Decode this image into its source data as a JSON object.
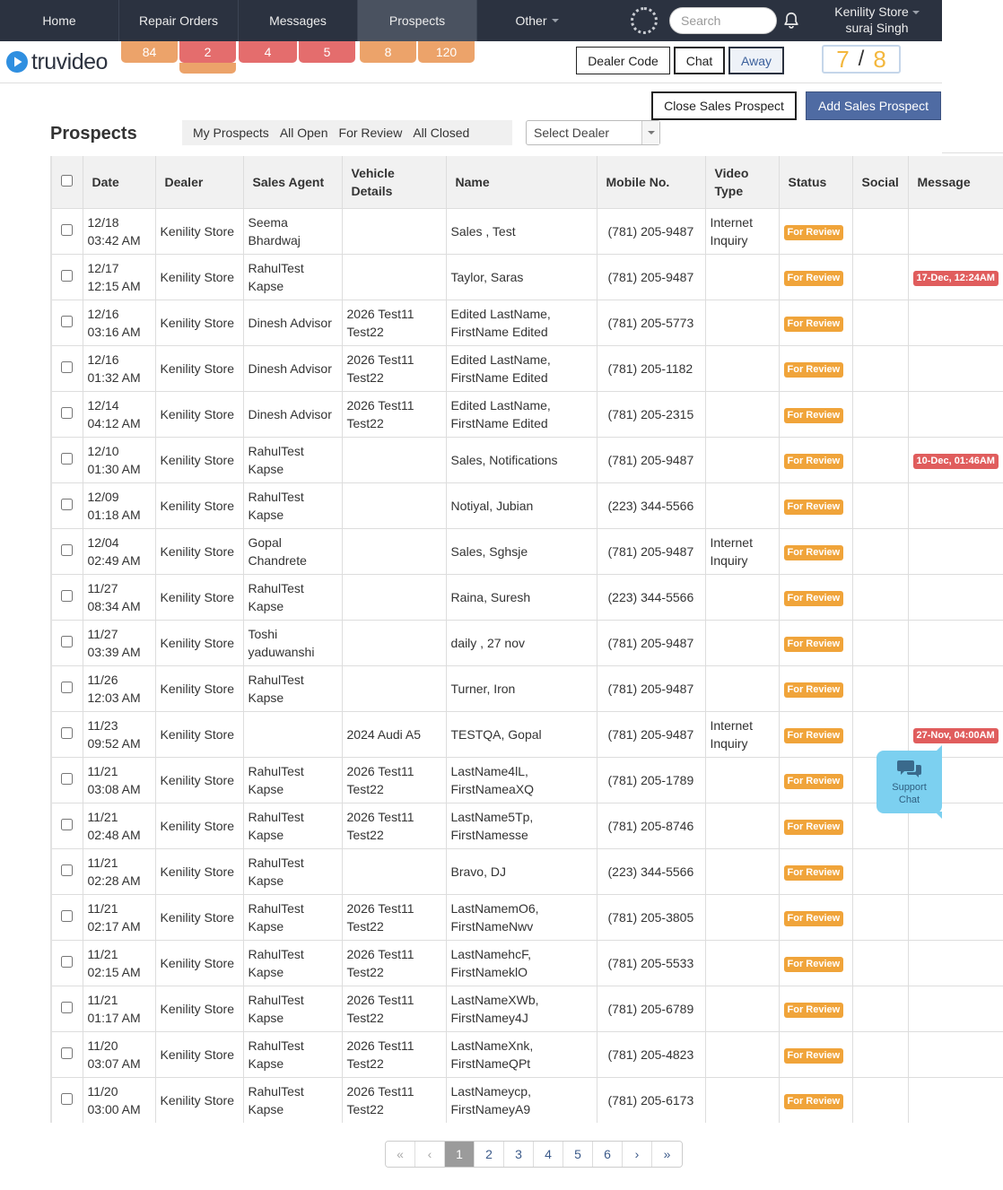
{
  "nav": {
    "items": [
      {
        "label": "Home",
        "active": false
      },
      {
        "label": "Repair Orders",
        "active": false
      },
      {
        "label": "Messages",
        "active": false
      },
      {
        "label": "Prospects",
        "active": true
      },
      {
        "label": "Other",
        "active": false
      }
    ],
    "search_placeholder": "Search",
    "store_name": "Kenility Store",
    "user_name": "suraj Singh"
  },
  "logo_text": "truvideo",
  "badges": [
    {
      "value": "84",
      "color": "orange"
    },
    {
      "value": "2",
      "color": "red"
    },
    {
      "value": "4",
      "color": "red"
    },
    {
      "value": "5",
      "color": "red"
    },
    {
      "value": "8",
      "color": "orange"
    },
    {
      "value": "120",
      "color": "orange"
    }
  ],
  "header_buttons": {
    "dealer_code": "Dealer Code",
    "chat": "Chat",
    "away": "Away"
  },
  "counter": {
    "left": "7",
    "sep": "/",
    "right": "8"
  },
  "toolbar": {
    "close_label": "Close Sales Prospect",
    "add_label": "Add Sales Prospect"
  },
  "page_title": "Prospects",
  "filter_tabs": [
    "My Prospects",
    "All Open",
    "For Review",
    "All Closed"
  ],
  "dealer_select_value": "Select Dealer",
  "table": {
    "columns": [
      "Date",
      "Dealer",
      "Sales Agent",
      "Vehicle Details",
      "Name",
      "Mobile No.",
      "Video Type",
      "Status",
      "Social",
      "Message"
    ],
    "rows": [
      {
        "date": "12/18\n03:42 AM",
        "dealer": "Kenility Store",
        "agent": "Seema Bhardwaj",
        "vehicle": "",
        "name": "Sales , Test",
        "mobile": "(781) 205-9487",
        "video_type": "Internet Inquiry",
        "status": "For Review",
        "social": "",
        "message": ""
      },
      {
        "date": "12/17\n12:15 AM",
        "dealer": "Kenility Store",
        "agent": "RahulTest Kapse",
        "vehicle": "",
        "name": "Taylor, Saras",
        "mobile": "(781) 205-9487",
        "video_type": "",
        "status": "For Review",
        "social": "",
        "message": "17-Dec, 12:24AM"
      },
      {
        "date": "12/16\n03:16 AM",
        "dealer": "Kenility Store",
        "agent": "Dinesh Advisor",
        "vehicle": "2026 Test11 Test22",
        "name": "Edited LastName, FirstName Edited",
        "mobile": "(781) 205-5773",
        "video_type": "",
        "status": "For Review",
        "social": "",
        "message": ""
      },
      {
        "date": "12/16\n01:32 AM",
        "dealer": "Kenility Store",
        "agent": "Dinesh Advisor",
        "vehicle": "2026 Test11 Test22",
        "name": "Edited LastName, FirstName Edited",
        "mobile": "(781) 205-1182",
        "video_type": "",
        "status": "For Review",
        "social": "",
        "message": ""
      },
      {
        "date": "12/14\n04:12 AM",
        "dealer": "Kenility Store",
        "agent": "Dinesh Advisor",
        "vehicle": "2026 Test11 Test22",
        "name": "Edited LastName, FirstName Edited",
        "mobile": "(781) 205-2315",
        "video_type": "",
        "status": "For Review",
        "social": "",
        "message": ""
      },
      {
        "date": "12/10\n01:30 AM",
        "dealer": "Kenility Store",
        "agent": "RahulTest Kapse",
        "vehicle": "",
        "name": "Sales, Notifications",
        "mobile": "(781) 205-9487",
        "video_type": "",
        "status": "For Review",
        "social": "",
        "message": "10-Dec, 01:46AM"
      },
      {
        "date": "12/09\n01:18 AM",
        "dealer": "Kenility Store",
        "agent": "RahulTest Kapse",
        "vehicle": "",
        "name": "Notiyal, Jubian",
        "mobile": "(223) 344-5566",
        "video_type": "",
        "status": "For Review",
        "social": "",
        "message": ""
      },
      {
        "date": "12/04\n02:49 AM",
        "dealer": "Kenility Store",
        "agent": "Gopal Chandrete",
        "vehicle": "",
        "name": "Sales, Sghsje",
        "mobile": "(781) 205-9487",
        "video_type": "Internet Inquiry",
        "status": "For Review",
        "social": "",
        "message": ""
      },
      {
        "date": "11/27\n08:34 AM",
        "dealer": "Kenility Store",
        "agent": "RahulTest Kapse",
        "vehicle": "",
        "name": "Raina, Suresh",
        "mobile": "(223) 344-5566",
        "video_type": "",
        "status": "For Review",
        "social": "",
        "message": ""
      },
      {
        "date": "11/27\n03:39 AM",
        "dealer": "Kenility Store",
        "agent": "Toshi yaduwanshi",
        "vehicle": "",
        "name": "daily , 27 nov",
        "mobile": "(781) 205-9487",
        "video_type": "",
        "status": "For Review",
        "social": "",
        "message": ""
      },
      {
        "date": "11/26\n12:03 AM",
        "dealer": "Kenility Store",
        "agent": "RahulTest Kapse",
        "vehicle": "",
        "name": "Turner, Iron",
        "mobile": "(781) 205-9487",
        "video_type": "",
        "status": "For Review",
        "social": "",
        "message": ""
      },
      {
        "date": "11/23\n09:52 AM",
        "dealer": "Kenility Store",
        "agent": "",
        "vehicle": "2024 Audi A5",
        "name": "TESTQA, Gopal",
        "mobile": "(781) 205-9487",
        "video_type": "Internet Inquiry",
        "status": "For Review",
        "social": "",
        "message": "27-Nov, 04:00AM"
      },
      {
        "date": "11/21\n03:08 AM",
        "dealer": "Kenility Store",
        "agent": "RahulTest Kapse",
        "vehicle": "2026 Test11 Test22",
        "name": "LastName4lL, FirstNameaXQ",
        "mobile": "(781) 205-1789",
        "video_type": "",
        "status": "For Review",
        "social": "",
        "message": ""
      },
      {
        "date": "11/21\n02:48 AM",
        "dealer": "Kenility Store",
        "agent": "RahulTest Kapse",
        "vehicle": "2026 Test11 Test22",
        "name": "LastName5Tp, FirstNamesse",
        "mobile": "(781) 205-8746",
        "video_type": "",
        "status": "For Review",
        "social": "",
        "message": ""
      },
      {
        "date": "11/21\n02:28 AM",
        "dealer": "Kenility Store",
        "agent": "RahulTest Kapse",
        "vehicle": "",
        "name": "Bravo, DJ",
        "mobile": "(223) 344-5566",
        "video_type": "",
        "status": "For Review",
        "social": "",
        "message": ""
      },
      {
        "date": "11/21\n02:17 AM",
        "dealer": "Kenility Store",
        "agent": "RahulTest Kapse",
        "vehicle": "2026 Test11 Test22",
        "name": "LastNamemO6, FirstNameNwv",
        "mobile": "(781) 205-3805",
        "video_type": "",
        "status": "For Review",
        "social": "",
        "message": ""
      },
      {
        "date": "11/21\n02:15 AM",
        "dealer": "Kenility Store",
        "agent": "RahulTest Kapse",
        "vehicle": "2026 Test11 Test22",
        "name": "LastNamehcF, FirstNameklO",
        "mobile": "(781) 205-5533",
        "video_type": "",
        "status": "For Review",
        "social": "",
        "message": ""
      },
      {
        "date": "11/21\n01:17 AM",
        "dealer": "Kenility Store",
        "agent": "RahulTest Kapse",
        "vehicle": "2026 Test11 Test22",
        "name": "LastNameXWb, FirstNamey4J",
        "mobile": "(781) 205-6789",
        "video_type": "",
        "status": "For Review",
        "social": "",
        "message": ""
      },
      {
        "date": "11/20\n03:07 AM",
        "dealer": "Kenility Store",
        "agent": "RahulTest Kapse",
        "vehicle": "2026 Test11 Test22",
        "name": "LastNameXnk, FirstNameQPt",
        "mobile": "(781) 205-4823",
        "video_type": "",
        "status": "For Review",
        "social": "",
        "message": ""
      },
      {
        "date": "11/20\n03:00 AM",
        "dealer": "Kenility Store",
        "agent": "RahulTest Kapse",
        "vehicle": "2026 Test11 Test22",
        "name": "LastNameycp, FirstNameyA9",
        "mobile": "(781) 205-6173",
        "video_type": "",
        "status": "For Review",
        "social": "",
        "message": ""
      }
    ]
  },
  "support_chat": {
    "line1": "Support",
    "line2": "Chat"
  },
  "pagination": {
    "first": "«",
    "prev": "‹",
    "next": "›",
    "last": "»",
    "pages": [
      "1",
      "2",
      "3",
      "4",
      "5",
      "6"
    ],
    "current": "1"
  },
  "colors": {
    "navbar": "#2b3240",
    "status_pill": "#f0a43a",
    "message_pill": "#e05d5d",
    "add_button": "#4f6ba3"
  }
}
